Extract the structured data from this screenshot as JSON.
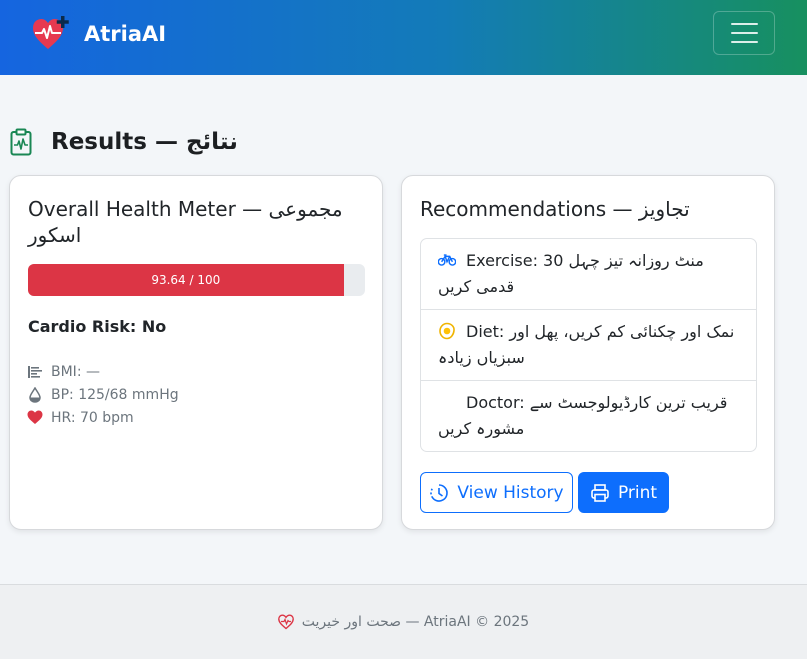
{
  "navbar": {
    "brand": "AtriaAI",
    "brand_color": "#e63950",
    "menu_icon": "hamburger-icon"
  },
  "page": {
    "title": "Results — نتائج",
    "title_icon": "clipboard-pulse-icon"
  },
  "health_card": {
    "title": "Overall Health Meter — مجموعی اسکور",
    "meter_label": "93.64 / 100",
    "meter_value": 93.64,
    "meter_max": 100,
    "meter_color": "#dc3545",
    "cardio_risk": "Cardio Risk: No",
    "stats": [
      {
        "icon": "bmi-icon",
        "text": "BMI: —"
      },
      {
        "icon": "blood-drop-icon",
        "text": "BP: 125/68 mmHg"
      },
      {
        "icon": "heart-icon",
        "text": "HR: 70 bpm"
      }
    ]
  },
  "recommendations_card": {
    "title": "Recommendations — تجاویز",
    "items": [
      {
        "icon": "bicycle-icon",
        "text": "Exercise: 30 منٹ روزانہ تیز چہل قدمی کریں"
      },
      {
        "icon": "egg-icon",
        "text": "Diet: نمک اور چکنائی کم کریں، پھل اور سبزیاں زیادہ"
      },
      {
        "icon": "",
        "text": "Doctor: قریب ترین کارڈیولوجسٹ سے مشورہ کریں"
      }
    ],
    "view_history_label": "View History",
    "print_label": "Print"
  },
  "footer": {
    "text": "صحت اور خیریت — AtriaAI © 2025"
  },
  "colors": {
    "primary": "#0d6efd",
    "danger": "#dc3545",
    "success": "#198754"
  }
}
